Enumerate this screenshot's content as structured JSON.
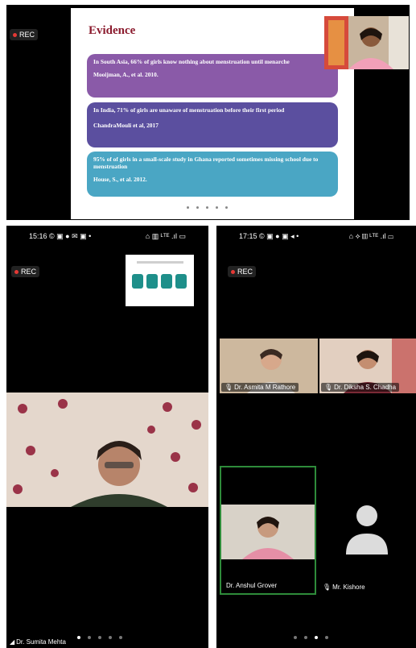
{
  "top": {
    "rec_label": "REC",
    "slide": {
      "title": "Evidence",
      "cards": [
        {
          "text": "In South Asia, 66% of girls know nothing about menstruation until menarche",
          "cite": "Mooijman, A., et al. 2010.",
          "color": "#8a5aa8"
        },
        {
          "text": "In India, 71% of girls are unaware of menstruation before their first period",
          "cite": "ChandraMouli et al, 2017",
          "color": "#5b4f9f"
        },
        {
          "text": "95% of of girls in a small-scale study in Ghana reported sometimes missing school due to menstruation",
          "cite": "House, S., et al. 2012.",
          "color": "#4aa6c4"
        }
      ]
    }
  },
  "left": {
    "status_time": "15:16",
    "status_icons_left": "© ▣ ● ✉ ▣ •",
    "status_icons_right": "⌂ ▥ ᴸᵀᴱ .ıl ▭",
    "rec_label": "REC",
    "speaker_name": "Dr. Sumita Mehta"
  },
  "right": {
    "status_time": "17:15",
    "status_icons_left": "© ▣ ● ▣ ◂ •",
    "status_icons_right": "⌂ ⟡ ▥ ᴸᵀᴱ .ıl ▭",
    "rec_label": "REC",
    "participants": [
      {
        "name": "Dr. Asmita M Rathore"
      },
      {
        "name": "Dr. Diksha S. Chadha"
      },
      {
        "name": "Dr. Anshul Grover"
      },
      {
        "name": "Mr. Kishore"
      }
    ]
  }
}
